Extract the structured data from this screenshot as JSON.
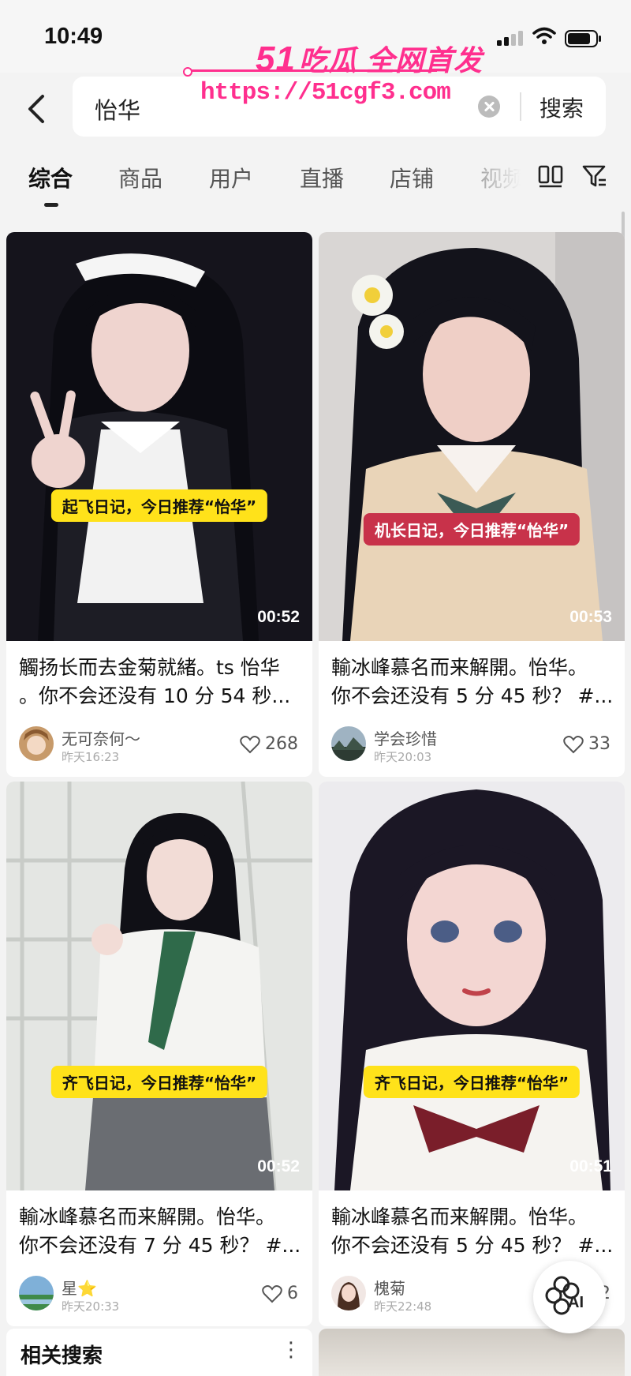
{
  "status": {
    "time": "10:49"
  },
  "watermark": {
    "brand_num": "51",
    "brand_text": "吃瓜 全网首发",
    "url": "https://51cgf3.com"
  },
  "search": {
    "query": "怡华",
    "button": "搜索"
  },
  "tabs": [
    "综合",
    "商品",
    "用户",
    "直播",
    "店铺",
    "视频"
  ],
  "active_tab": "综合",
  "cards": [
    {
      "caption": "起飞日记，今日推荐“怡华”",
      "duration": "00:52",
      "title_line1": "觸扬长而去金菊就緒。ts 怡华",
      "title_line2": "。你不会还没有 10 分 54 秒...",
      "user": "无可奈何～",
      "date": "昨天16:23",
      "likes": "268"
    },
    {
      "caption": "机长日记，今日推荐“怡华”",
      "duration": "00:53",
      "title_line1": "輸冰峰慕名而来解開。怡华。",
      "title_line2": "你不会还没有 5 分 45 秒？ #...",
      "user": "学会珍惜",
      "date": "昨天20:03",
      "likes": "33"
    },
    {
      "caption": "齐飞日记，今日推荐“怡华”",
      "duration": "00:52",
      "title_line1": "輸冰峰慕名而来解開。怡华。",
      "title_line2": "你不会还没有 7 分 45 秒？ #...",
      "user": "星⭐",
      "date": "昨天20:33",
      "likes": "6"
    },
    {
      "caption": "齐飞日记，今日推荐“怡华”",
      "duration": "00:51",
      "title_line1": "輸冰峰慕名而来解開。怡华。",
      "title_line2": "你不会还没有 5 分 45 秒？ #...",
      "user": "槐菊",
      "date": "昨天22:48",
      "likes": "2"
    }
  ],
  "ai_button": "AI",
  "related": {
    "label": "相关搜索"
  }
}
